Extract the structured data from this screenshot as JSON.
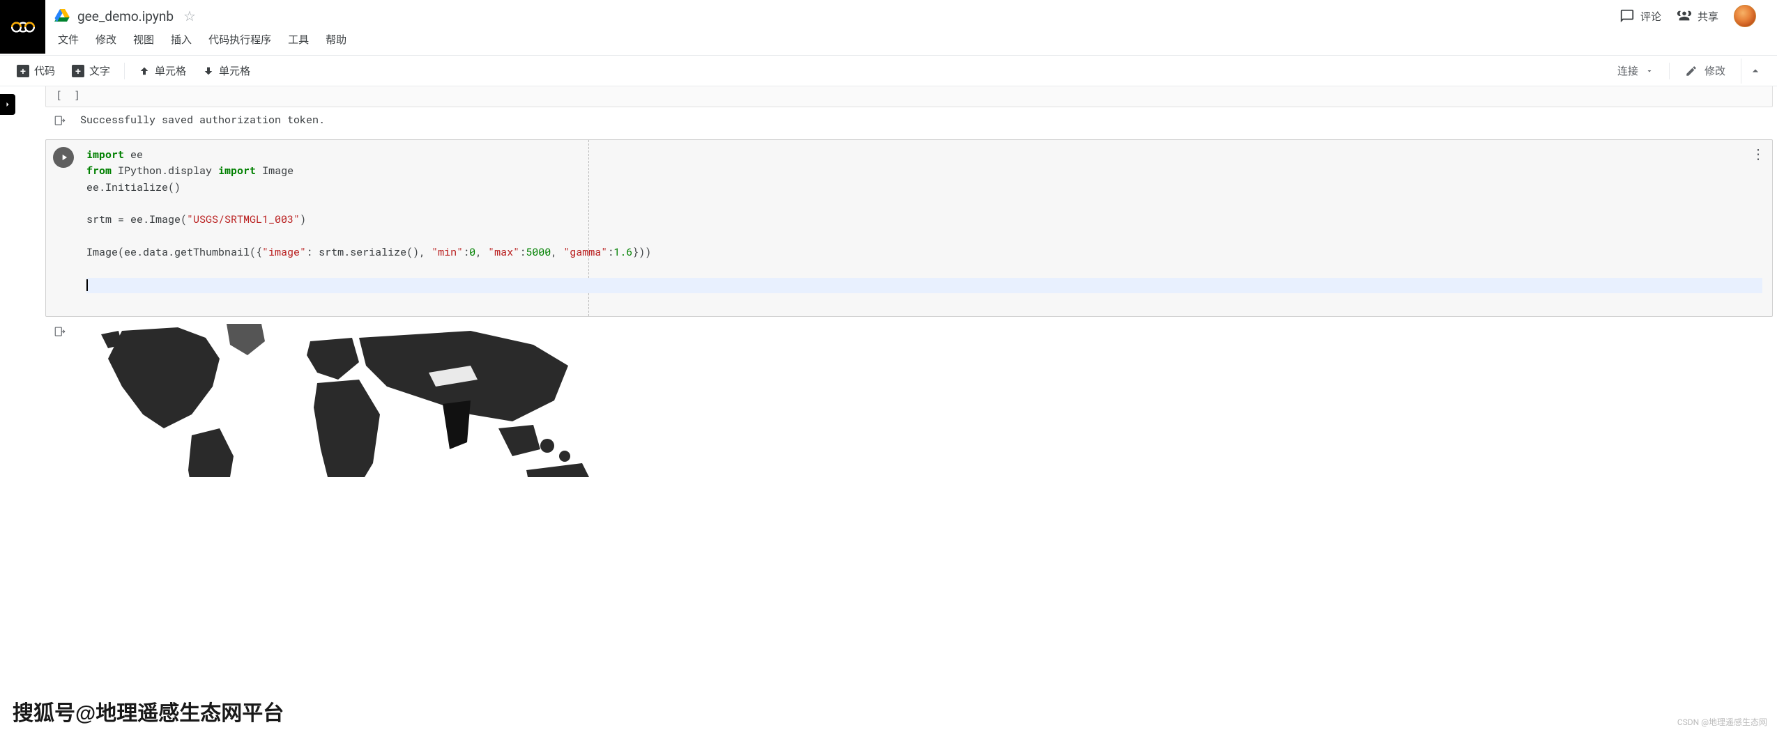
{
  "header": {
    "filename": "gee_demo.ipynb",
    "comment_label": "评论",
    "share_label": "共享"
  },
  "menu": {
    "file": "文件",
    "edit": "修改",
    "view": "视图",
    "insert": "插入",
    "runtime": "代码执行程序",
    "tools": "工具",
    "help": "帮助"
  },
  "toolbar": {
    "code_label": "代码",
    "text_label": "文字",
    "cell_up_label": "单元格",
    "cell_down_label": "单元格",
    "connect_label": "连接",
    "edit_label": "修改"
  },
  "cells": {
    "prev_brackets": "[  ]",
    "output1": "Successfully saved authorization token.",
    "code": {
      "l1_kw1": "import",
      "l1_rest": " ee",
      "l2_kw1": "from",
      "l2_mid": " IPython.display ",
      "l2_kw2": "import",
      "l2_rest": " Image",
      "l3": "ee.Initialize()",
      "l4_a": "srtm = ee.Image(",
      "l4_str": "\"USGS/SRTMGL1_003\"",
      "l4_b": ")",
      "l5_a": "Image(ee.data.getThumbnail({",
      "l5_s1": "\"image\"",
      "l5_b": ": srtm.serialize(), ",
      "l5_s2": "\"min\"",
      "l5_c": ":",
      "l5_n1": "0",
      "l5_d": ", ",
      "l5_s3": "\"max\"",
      "l5_e": ":",
      "l5_n2": "5000",
      "l5_f": ", ",
      "l5_s4": "\"gamma\"",
      "l5_g": ":",
      "l5_n3": "1.6",
      "l5_h": "}))"
    }
  },
  "watermarks": {
    "left": "搜狐号@地理遥感生态网平台",
    "right": "CSDN @地理遥感生态网"
  }
}
